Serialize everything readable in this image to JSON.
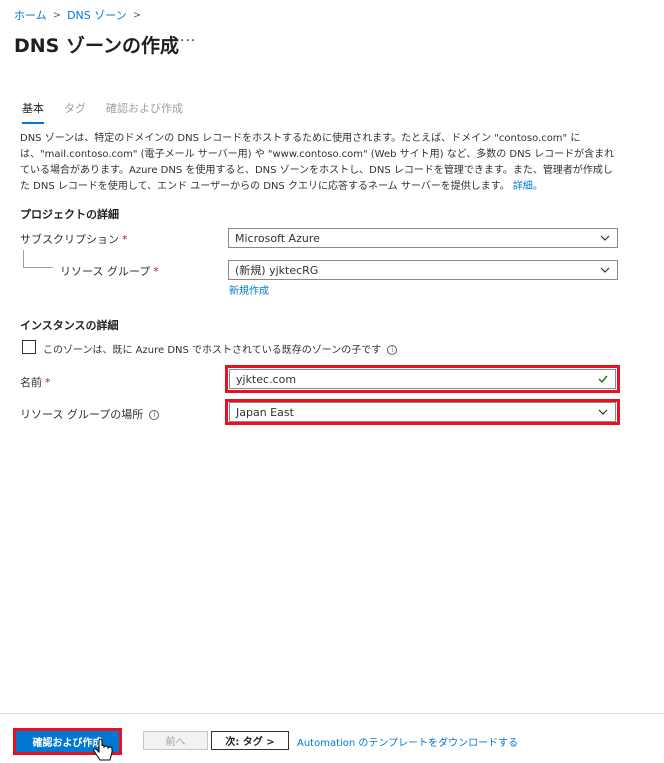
{
  "breadcrumb": {
    "home": "ホーム",
    "dns_zones": "DNS ゾーン"
  },
  "page": {
    "title": "DNS ゾーンの作成",
    "more": "···"
  },
  "tabs": [
    "基本",
    "タグ",
    "確認および作成"
  ],
  "description": {
    "text": "DNS ゾーンは、特定のドメインの DNS レコードをホストするために使用されます。たとえば、ドメイン \"contoso.com\" には、\"mail.contoso.com\" (電子メール サーバー用) や \"www.contoso.com\" (Web サイト用) など、多数の DNS レコードが含まれている場合があります。Azure DNS を使用すると、DNS ゾーンをホストし、DNS レコードを管理できます。また、管理者が作成した DNS レコードを使用して、エンド ユーザーからの DNS クエリに応答するネーム サーバーを提供します。",
    "link": "詳細。"
  },
  "project": {
    "section_title": "プロジェクトの詳細",
    "subscription_label": "サブスクリプション",
    "subscription_value": "Microsoft Azure",
    "rg_label": "リソース グループ",
    "rg_value": "(新規) yjktecRG",
    "create_new": "新規作成"
  },
  "instance": {
    "section_title": "インスタンスの詳細",
    "child_zone_label": "このゾーンは、既に Azure DNS でホストされている既存のゾーンの子です",
    "name_label": "名前",
    "name_value": "yjktec.com",
    "location_label": "リソース グループの場所",
    "location_value": "Japan East"
  },
  "required_mark": "*",
  "footer": {
    "review_create": "確認および作成",
    "previous": "前へ",
    "next": "次: タグ >",
    "automation": "Automation のテンプレートをダウンロードする"
  },
  "colors": {
    "accent": "#0078d4",
    "highlight": "#e81123",
    "valid": "#107c10"
  }
}
